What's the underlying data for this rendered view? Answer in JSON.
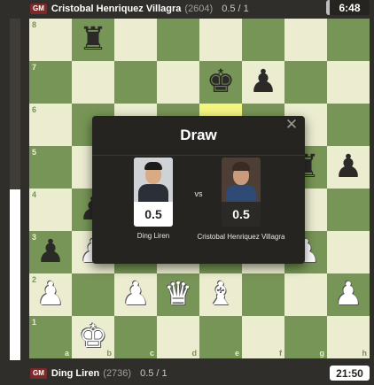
{
  "top_player": {
    "badge": "GM",
    "name": "Cristobal Henriquez Villagra",
    "rating": "(2604)",
    "score": "0.5 / 1",
    "clock": "6:48"
  },
  "bottom_player": {
    "badge": "GM",
    "name": "Ding Liren",
    "rating": "(2736)",
    "score": "0.5 / 1",
    "clock": "21:50"
  },
  "eval_bar": {
    "white_share": 0.5
  },
  "board": {
    "ranks": [
      "8",
      "7",
      "6",
      "5",
      "4",
      "3",
      "2",
      "1"
    ],
    "files": [
      "a",
      "b",
      "c",
      "d",
      "e",
      "f",
      "g",
      "h"
    ],
    "highlight": [
      "e6"
    ],
    "pieces": {
      "b8": "black-rook",
      "e7": "black-king",
      "f7": "black-pawn",
      "g5": "black-rook",
      "h5": "black-pawn",
      "b4": "black-pawn",
      "a3": "black-pawn",
      "b3": "white-pawn",
      "g3": "white-pawn",
      "a2": "white-pawn",
      "c2": "white-pawn",
      "d2": "white-queen",
      "e2": "white-bishop",
      "h2": "white-pawn",
      "b1": "white-king"
    }
  },
  "modal": {
    "title": "Draw",
    "close_label": "✕",
    "vs_label": "vs",
    "left": {
      "name": "Ding Liren",
      "score": "0.5"
    },
    "right": {
      "name": "Cristobal Henriquez Villagra",
      "score": "0.5"
    }
  }
}
